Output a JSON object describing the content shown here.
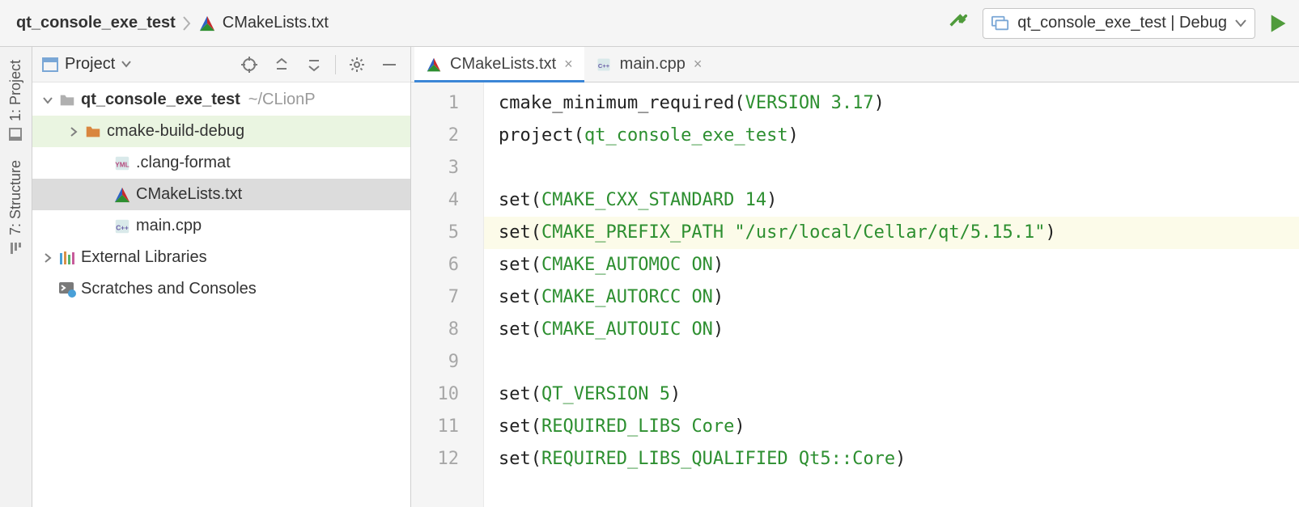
{
  "breadcrumb": {
    "project": "qt_console_exe_test",
    "file": "CMakeLists.txt"
  },
  "runconfig": {
    "label": "qt_console_exe_test | Debug"
  },
  "left_tools": {
    "project": "1: Project",
    "structure": "7: Structure"
  },
  "project_panel": {
    "title": "Project"
  },
  "tree": {
    "root_name": "qt_console_exe_test",
    "root_path": "~/CLionP",
    "cmake_build": "cmake-build-debug",
    "clang_format": ".clang-format",
    "cmakelists": "CMakeLists.txt",
    "main_cpp": "main.cpp",
    "external": "External Libraries",
    "scratches": "Scratches and Consoles"
  },
  "tabs": {
    "t0": "CMakeLists.txt",
    "t1": "main.cpp"
  },
  "code": {
    "l1a": "cmake_minimum_required",
    "l1b": "VERSION",
    "l1c": "3.17",
    "l2a": "project",
    "l2b": "qt_console_exe_test",
    "l4a": "set",
    "l4b": "CMAKE_CXX_STANDARD",
    "l4c": "14",
    "l5a": "set",
    "l5b": "CMAKE_PREFIX_PATH",
    "l5c": "\"/usr/local/Cellar/qt/5.15.1\"",
    "l6a": "set",
    "l6b": "CMAKE_AUTOMOC",
    "l6c": "ON",
    "l7a": "set",
    "l7b": "CMAKE_AUTORCC",
    "l7c": "ON",
    "l8a": "set",
    "l8b": "CMAKE_AUTOUIC",
    "l8c": "ON",
    "l10a": "set",
    "l10b": "QT_VERSION",
    "l10c": "5",
    "l11a": "set",
    "l11b": "REQUIRED_LIBS",
    "l11c": "Core",
    "l12a": "set",
    "l12b": "REQUIRED_LIBS_QUALIFIED",
    "l12c": "Qt5::Core"
  },
  "line_numbers": [
    "1",
    "2",
    "3",
    "4",
    "5",
    "6",
    "7",
    "8",
    "9",
    "10",
    "11",
    "12"
  ]
}
